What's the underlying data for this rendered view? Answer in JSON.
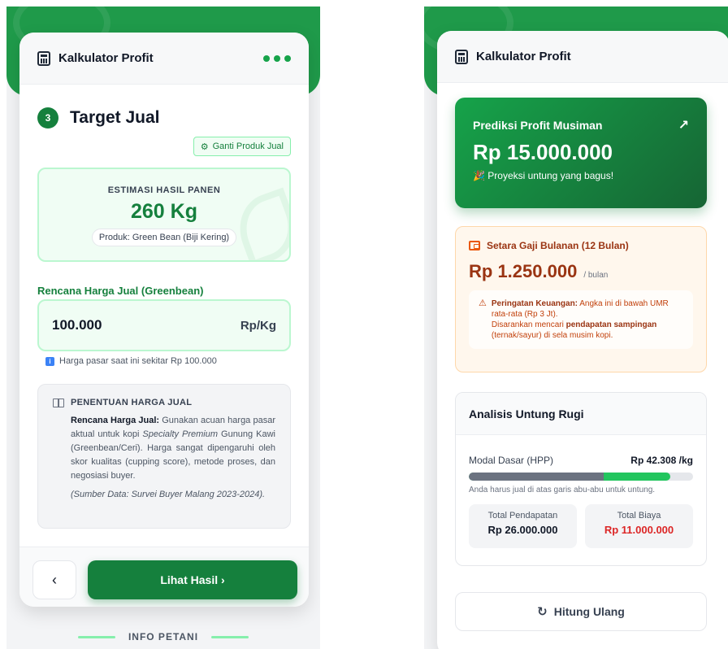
{
  "app": {
    "title": "Kalkulator Profit"
  },
  "left": {
    "step_number": "3",
    "step_title": "Target Jual",
    "change_product_label": "Ganti Produk Jual",
    "harvest": {
      "label": "ESTIMASI HASIL PANEN",
      "value": "260 Kg",
      "product": "Produk: Green Bean (Biji Kering)"
    },
    "price": {
      "label": "Rencana Harga Jual (Greenbean)",
      "value": "100.000",
      "unit": "Rp/Kg",
      "hint": "Harga pasar saat ini sekitar Rp 100.000"
    },
    "rule": {
      "heading": "PENENTUAN HARGA JUAL",
      "bold_lead": "Rencana Harga Jual:",
      "text_1": " Gunakan acuan harga pasar aktual untuk kopi ",
      "italic_1": "Specialty Premium",
      "text_2": " Gunung Kawi (Greenbean/Ceri). Harga sangat dipengaruhi oleh skor kualitas (cupping score), metode proses, dan negosiasi buyer.",
      "source": "(Sumber Data: Survei Buyer Malang 2023-2024)."
    },
    "back_label": "‹",
    "next_label": "Lihat Hasil ›",
    "footer_brand": "INFO PETANI"
  },
  "right": {
    "profit": {
      "label": "Prediksi Profit Musiman",
      "value": "Rp 15.000.000",
      "note": "🎉 Proyeksi untung yang bagus!"
    },
    "salary": {
      "heading": "Setara Gaji Bulanan (12 Bulan)",
      "value": "Rp 1.250.000",
      "unit": "/ bulan",
      "warn_bold": "Peringatan Keuangan:",
      "warn_text_1": " Angka ini di bawah UMR rata-rata (Rp 3 Jt).",
      "warn_text_2": "Disarankan mencari ",
      "warn_bold_2": "pendapatan sampingan",
      "warn_text_3": " (ternak/sayur) di sela musim kopi."
    },
    "analysis": {
      "heading": "Analisis Untung Rugi",
      "hpp_label": "Modal Dasar (HPP)",
      "hpp_value": "Rp 42.308 /kg",
      "cost_share": 0.6,
      "bar_hint": "Anda harus jual di atas garis abu-abu untuk untung.",
      "revenue_label": "Total Pendapatan",
      "revenue_value": "Rp 26.000.000",
      "cost_label": "Total Biaya",
      "cost_value": "Rp 11.000.000"
    },
    "recalc_label": "Hitung Ulang"
  },
  "icons": {
    "calculator": "calculator-icon",
    "menu": "more-dots-icon",
    "gear": "gear-icon",
    "leaf": "leaf-icon",
    "info": "info-icon",
    "book": "book-icon",
    "trend": "trend-up-icon",
    "wallet": "wallet-icon",
    "warning": "warning-icon",
    "refresh": "refresh-icon"
  },
  "colors": {
    "brand_green": "#15803d",
    "accent_green": "#22c55e",
    "warning_orange": "#9a3412",
    "danger_red": "#dc2626"
  }
}
